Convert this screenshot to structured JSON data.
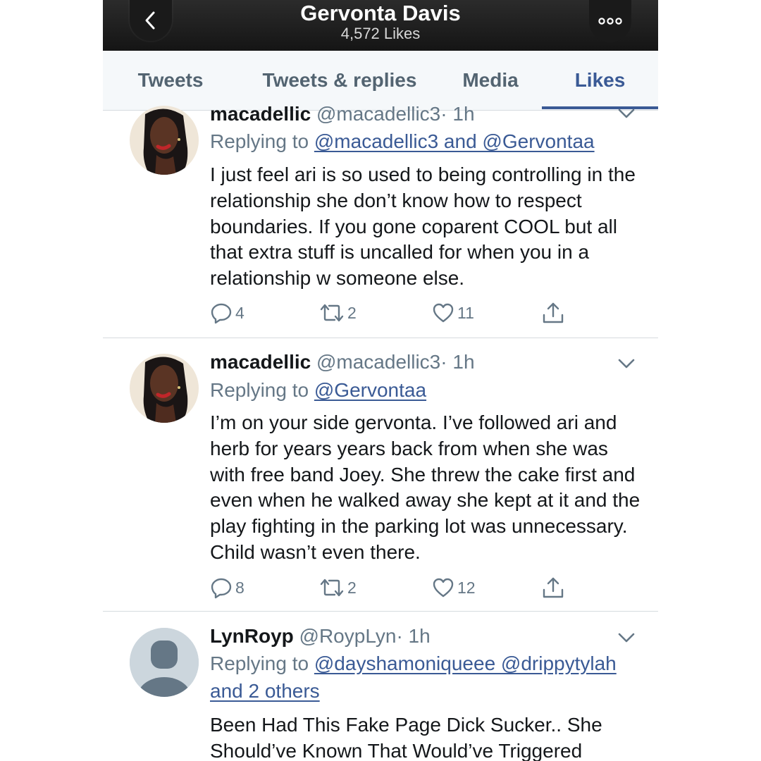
{
  "header": {
    "title": "Gervonta Davis",
    "subtitle": "4,572 Likes"
  },
  "tabs": [
    {
      "label": "Tweets"
    },
    {
      "label": "Tweets & replies"
    },
    {
      "label": "Media"
    },
    {
      "label": "Likes",
      "active": true
    }
  ],
  "tweets": [
    {
      "name": "macadellic",
      "handle": "@macadellic3",
      "time": "· 1h",
      "replying_prefix": "Replying to",
      "replying_mentions": "@macadellic3 and @Gervontaa",
      "text": "I just feel ari is so used to being controlling in the relationship she don’t know how to respect boundaries. If you gone coparent COOL but all that extra stuff is uncalled for when you in a relationship w someone else.",
      "replies": "4",
      "retweets": "2",
      "likes": "11"
    },
    {
      "name": "macadellic",
      "handle": "@macadellic3",
      "time": "· 1h",
      "replying_prefix": "Replying to",
      "replying_mentions": "@Gervontaa",
      "text": "I’m on your side gervonta. I’ve followed ari and herb for years years back from when she was with free band Joey. She threw the cake first and even when he walked away she kept at it and the play fighting in the parking lot was unnecessary. Child wasn’t even there.",
      "replies": "8",
      "retweets": "2",
      "likes": "12"
    },
    {
      "name": "LynRoyp",
      "handle": "@RoypLyn",
      "time": "· 1h",
      "replying_prefix": "Replying to",
      "replying_mentions": "@dayshamoniqueee @drippytylah and 2 others",
      "text": "Been Had This Fake Page Dick Sucker.. She Should’ve Known That Would’ve Triggered"
    }
  ],
  "icons": [
    "back-icon",
    "more-icon",
    "chevron-down-icon",
    "reply-icon",
    "retweet-icon",
    "like-icon",
    "share-icon"
  ],
  "colors": {
    "accent": "#3a5a95",
    "muted": "#657786",
    "header_bg": "#1c1c1c"
  }
}
